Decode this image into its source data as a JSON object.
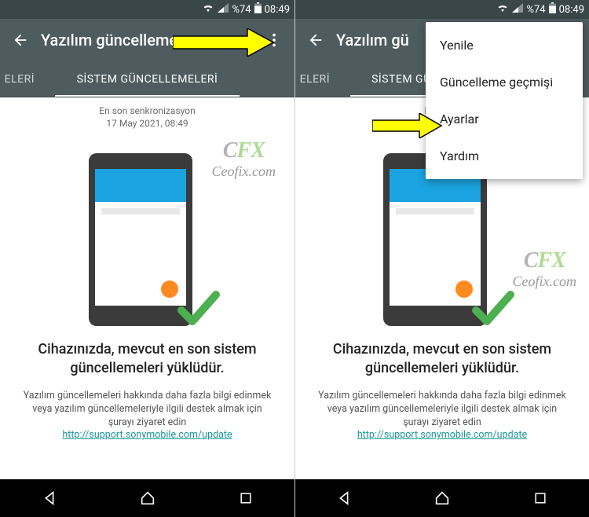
{
  "status": {
    "battery": "%74",
    "time": "08:49"
  },
  "appbar": {
    "title": "Yazılım güncelleme"
  },
  "tabs": {
    "left": "ELERİ",
    "main": "SİSTEM GÜNCELLEMELERİ"
  },
  "sync": {
    "line1": "En son senkronizasyon",
    "line2": "17 May 2021, 08:49",
    "partial": "En son s"
  },
  "body": {
    "status": "Cihazınızda, mevcut en son sistem güncellemeleri yüklüdür.",
    "info": "Yazılım güncellemeleri hakkında daha fazla bilgi edinmek veya yazılım güncellemeleriyle ilgili destek almak için şurayı ziyaret edin",
    "link": "http://support.sonymobile.com/update"
  },
  "menu": {
    "refresh": "Yenile",
    "history": "Güncelleme geçmişi",
    "settings": "Ayarlar",
    "help": "Yardım"
  },
  "watermark": {
    "brand_c": "C",
    "brand_fx": "FX",
    "site": "Ceofix.com"
  }
}
